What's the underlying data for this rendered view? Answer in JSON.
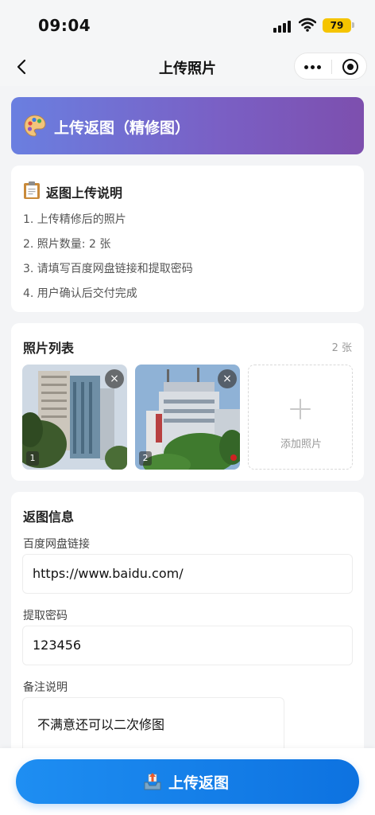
{
  "status_bar": {
    "time": "09:04",
    "battery": "79"
  },
  "nav": {
    "title": "上传照片"
  },
  "banner": {
    "title": "上传返图（精修图）"
  },
  "instructions": {
    "title": "返图上传说明",
    "items": [
      "1. 上传精修后的照片",
      "2. 照片数量: 2 张",
      "3. 请填写百度网盘链接和提取密码",
      "4. 用户确认后交付完成"
    ]
  },
  "photos": {
    "title": "照片列表",
    "count": "2 张",
    "items": [
      {
        "index": "1",
        "remove": "×"
      },
      {
        "index": "2",
        "remove": "×"
      }
    ],
    "add_label": "添加照片"
  },
  "info": {
    "title": "返图信息",
    "link_label": "百度网盘链接",
    "link_value": "https://www.baidu.com/",
    "password_label": "提取密码",
    "password_value": "123456",
    "note_label": "备注说明",
    "note_value": "不满意还可以二次修图"
  },
  "submit": {
    "label": "上传返图"
  }
}
